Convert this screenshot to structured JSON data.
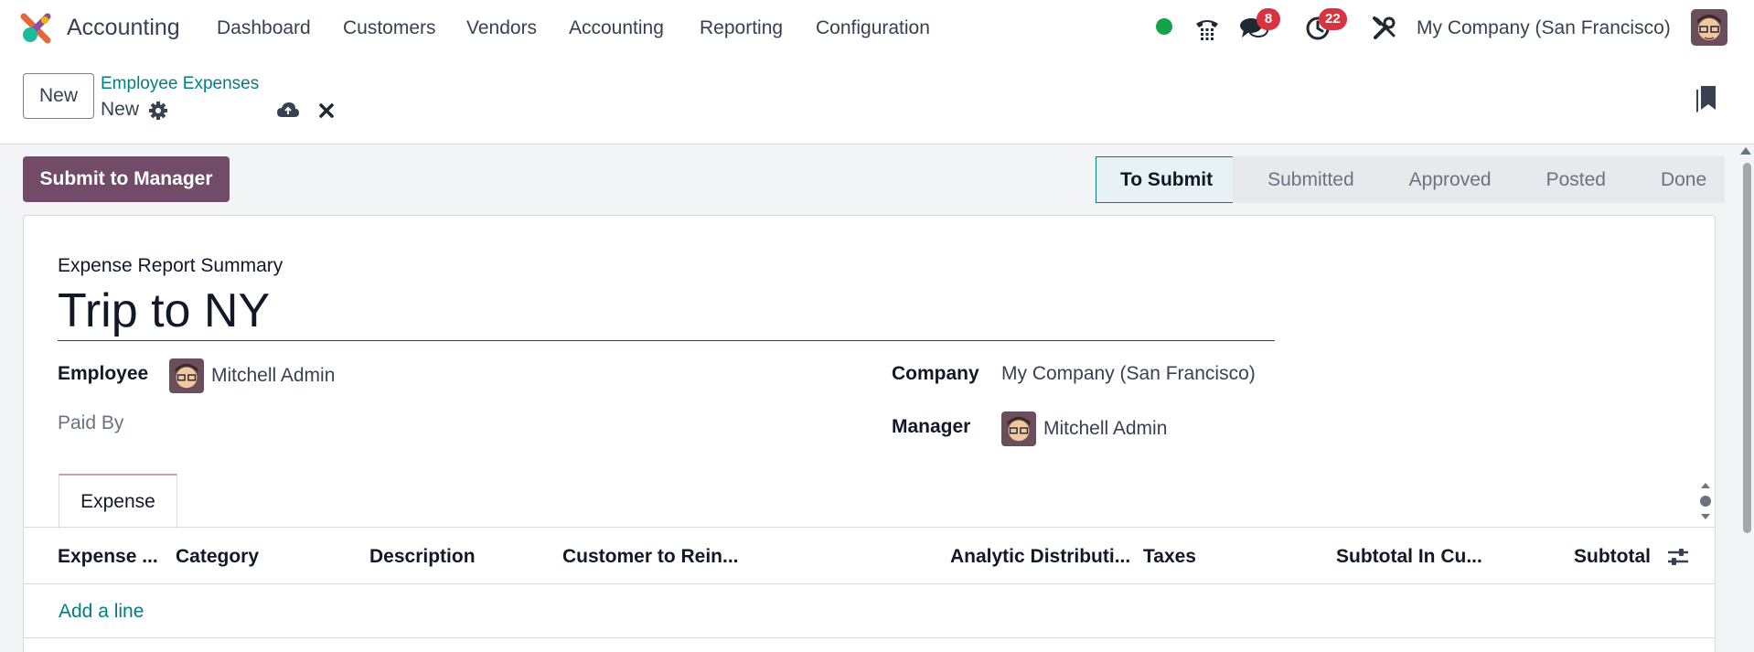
{
  "navbar": {
    "app_name": "Accounting",
    "menu": [
      "Dashboard",
      "Customers",
      "Vendors",
      "Accounting",
      "Reporting",
      "Configuration"
    ],
    "messages_badge": "8",
    "activities_badge": "22",
    "company": "My Company (San Francisco)",
    "status_color": "#14a34b",
    "icons": [
      "phone-icon",
      "chat-icon",
      "clock-icon",
      "tools-icon"
    ]
  },
  "control_panel": {
    "new_label": "New",
    "breadcrumb": "Employee Expenses",
    "record_name": "New"
  },
  "form": {
    "submit_label": "Submit to Manager",
    "stages": [
      "To Submit",
      "Submitted",
      "Approved",
      "Posted",
      "Done"
    ],
    "active_stage": "To Submit",
    "summary_label": "Expense Report Summary",
    "summary_value": "Trip to NY",
    "employee_label": "Employee",
    "employee_value": "Mitchell Admin",
    "paid_by_label": "Paid By",
    "company_label": "Company",
    "company_value": "My Company (San Francisco)",
    "manager_label": "Manager",
    "manager_value": "Mitchell Admin",
    "tab_label": "Expense",
    "columns": [
      "Expense ...",
      "Category",
      "Description",
      "Customer to Rein...",
      "Analytic Distributi...",
      "Taxes",
      "Subtotal In Cu...",
      "Subtotal"
    ],
    "add_line_label": "Add a line"
  },
  "colors": {
    "brand": "#714b67",
    "accent": "#017e84",
    "badge": "#d8343f"
  }
}
